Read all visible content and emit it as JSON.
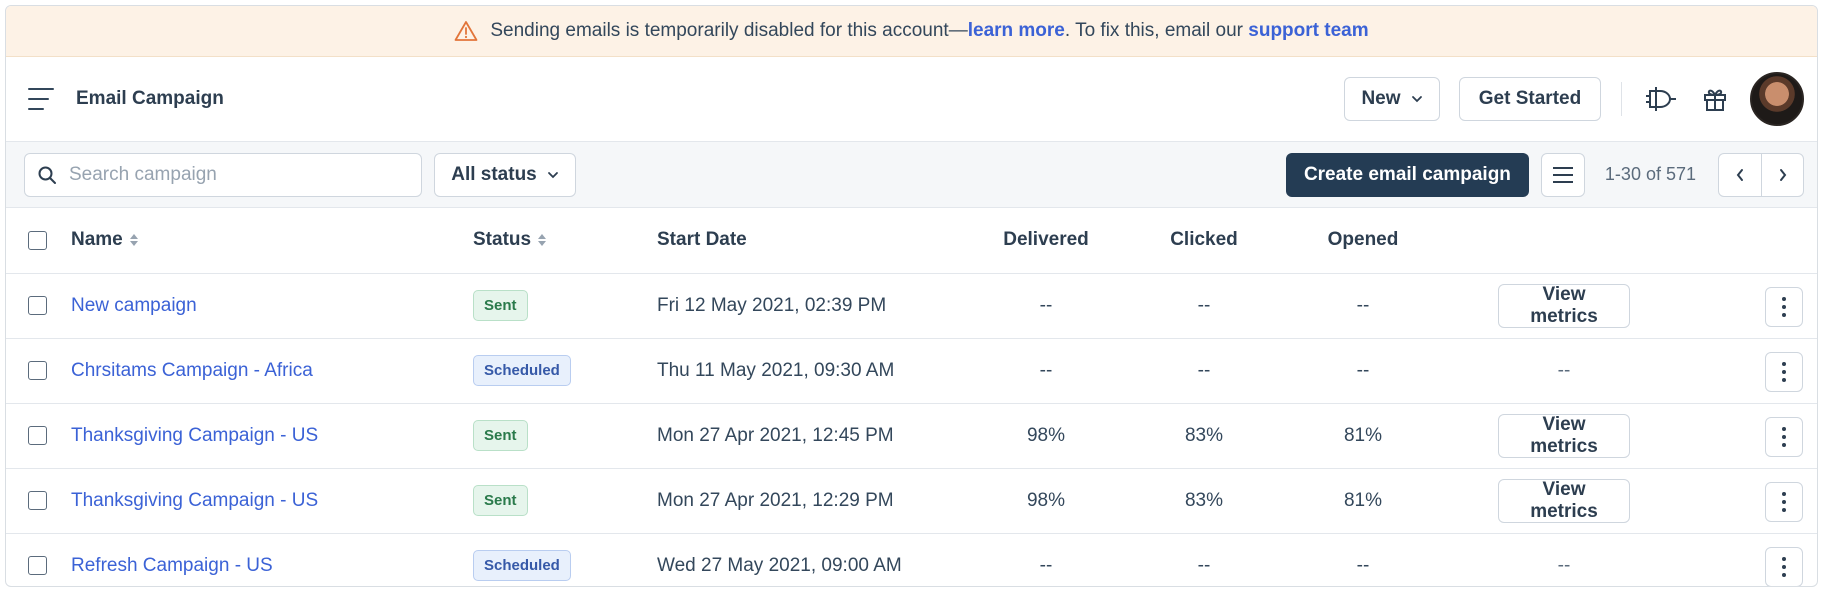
{
  "banner": {
    "text_before": "Sending emails is temporarily disabled for this account—",
    "learn_more": "learn more",
    "text_middle": ". To fix this, email our ",
    "support_team": "support team"
  },
  "header": {
    "title": "Email Campaign",
    "new_label": "New",
    "get_started_label": "Get Started"
  },
  "toolbar": {
    "search_placeholder": "Search campaign",
    "status_filter": "All status",
    "create_label": "Create email campaign",
    "pagination": "1-30 of 571"
  },
  "table": {
    "columns": [
      "Name",
      "Status",
      "Start Date",
      "Delivered",
      "Clicked",
      "Opened"
    ],
    "rows": [
      {
        "name": "New campaign",
        "status": "Sent",
        "start": "Fri 12 May 2021, 02:39 PM",
        "delivered": "--",
        "clicked": "--",
        "opened": "--",
        "metrics": "View metrics"
      },
      {
        "name": "Chrsitams Campaign - Africa",
        "status": "Scheduled",
        "start": "Thu 11 May 2021, 09:30 AM",
        "delivered": "--",
        "clicked": "--",
        "opened": "--",
        "metrics": "--"
      },
      {
        "name": "Thanksgiving Campaign - US",
        "status": "Sent",
        "start": "Mon 27 Apr 2021, 12:45 PM",
        "delivered": "98%",
        "clicked": "83%",
        "opened": "81%",
        "metrics": "View metrics"
      },
      {
        "name": "Thanksgiving Campaign - US",
        "status": "Sent",
        "start": "Mon 27 Apr 2021, 12:29 PM",
        "delivered": "98%",
        "clicked": "83%",
        "opened": "81%",
        "metrics": "View metrics"
      },
      {
        "name": "Refresh Campaign - US",
        "status": "Scheduled",
        "start": "Wed 27 May 2021, 09:00 AM",
        "delivered": "--",
        "clicked": "--",
        "opened": "--",
        "metrics": "--"
      }
    ]
  },
  "colors": {
    "banner_bg": "#fdf2e6",
    "link": "#3b62d6",
    "primary": "#243c54",
    "sent_badge": "#e6f5ec",
    "scheduled_badge": "#e8f0fc"
  },
  "icons": [
    "warning-icon",
    "hamburger-icon",
    "chevron-down-icon",
    "plug-icon",
    "gift-icon",
    "search-icon",
    "list-icon",
    "chevron-left-icon",
    "chevron-right-icon",
    "sort-icon",
    "kebab-icon"
  ]
}
